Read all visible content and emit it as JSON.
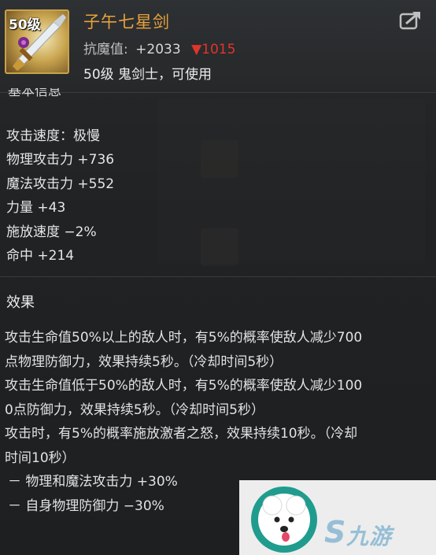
{
  "item": {
    "level_badge": "50级",
    "name": "子午七星剑",
    "resist_label": "抗魔值:",
    "resist_value": "+2033",
    "resist_diff": "▼1015",
    "requirement": "50级 鬼剑士，可使用",
    "icon": "sword-icon"
  },
  "basic_section": {
    "title": "基本信息"
  },
  "stats": [
    "攻击速度：极慢",
    "物理攻击力 +736",
    "魔法攻击力 +552",
    "力量 +43",
    "施放速度 −2%",
    "命中 +214"
  ],
  "effect": {
    "title": "效果",
    "lines": [
      "攻击生命值50%以上的敌人时，有5%的概率使敌人减少700",
      "点物理防御力，效果持续5秒。（冷却时间5秒）",
      "攻击生命值低于50%的敌人时，有5%的概率使敌人减少100",
      "0点防御力，效果持续5秒。（冷却时间5秒）",
      "攻击时，有5%的概率施放激者之怒，效果持续10秒。（冷却",
      "时间10秒）"
    ],
    "bullets": [
      " － 物理和魔法攻击力 +30%",
      " － 自身物理防御力 −30%"
    ]
  },
  "watermark": {
    "text": "九游",
    "s": "S"
  },
  "colors": {
    "item_name": "#e8a23a",
    "resist_down": "#e0352b",
    "frame": "#c8a24a"
  }
}
